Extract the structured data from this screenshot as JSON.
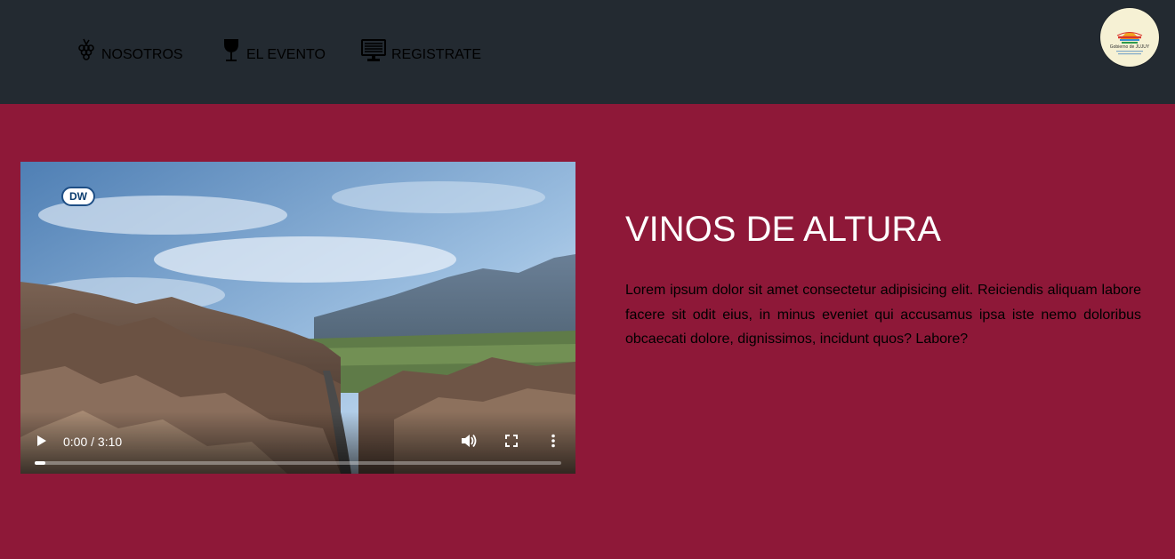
{
  "nav": {
    "items": [
      {
        "label": "NOSOTROS",
        "icon": "grapes-icon"
      },
      {
        "label": "EL EVENTO",
        "icon": "wine-glass-icon"
      },
      {
        "label": "REGISTRATE",
        "icon": "computer-monitor-icon"
      }
    ],
    "logo": {
      "text": "Gobierno de JUJUY"
    }
  },
  "video": {
    "channel_logo": "DW",
    "time": "0:00 / 3:10",
    "progress": 0.02
  },
  "hero": {
    "title": "VINOS DE ALTURA",
    "text": "Lorem ipsum dolor sit amet consectetur adipisicing elit. Reiciendis aliquam labore facere sit odit eius, in minus eveniet qui accusamus ipsa iste nemo doloribus obcaecati dolore, dignissimos, incidunt quos? Labore?"
  },
  "colors": {
    "navbar": "#232a31",
    "hero_background": "#8e1838",
    "title": "#ffffff",
    "body_text": "#000000"
  }
}
